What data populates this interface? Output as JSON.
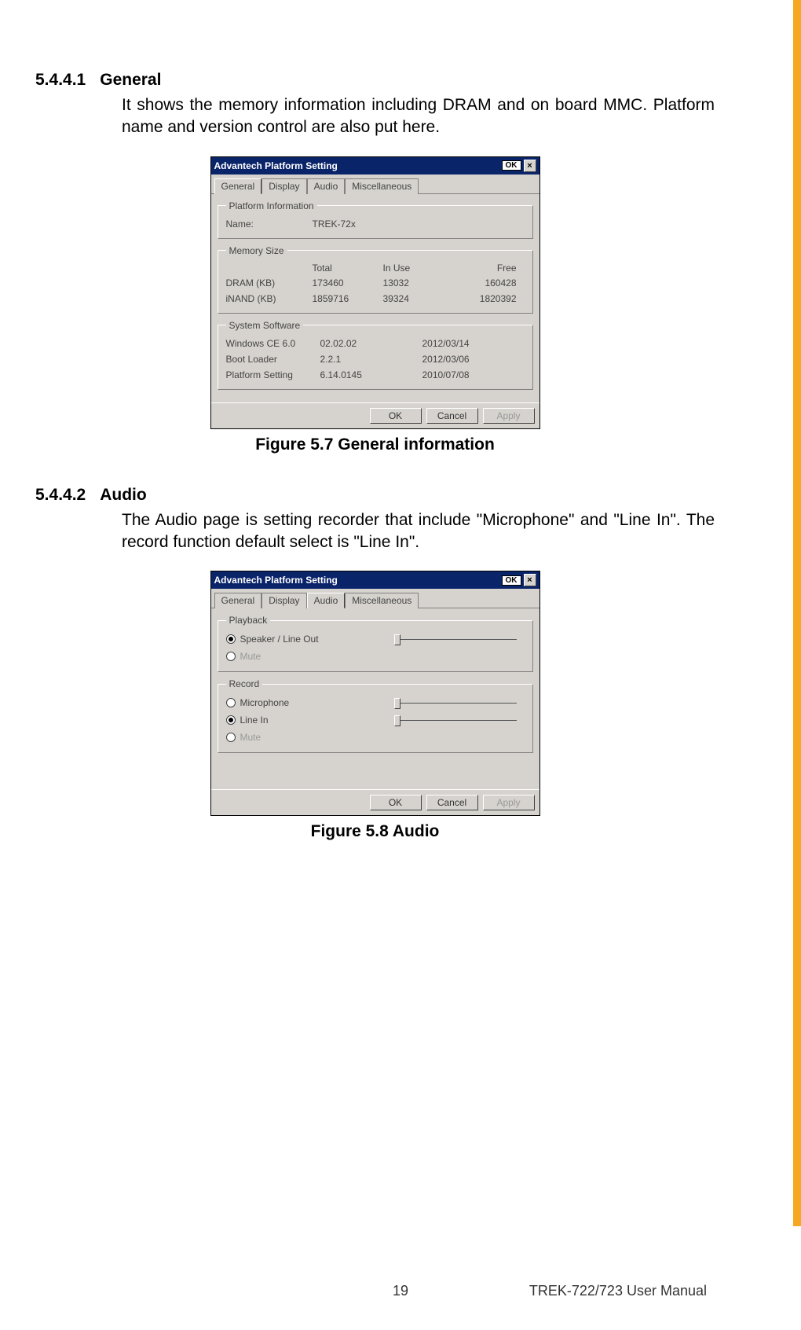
{
  "sections": {
    "general": {
      "num": "5.4.4.1",
      "title": "General",
      "body": "It shows the memory information including DRAM and on board MMC. Platform name and version control are also put here.",
      "caption": "Figure 5.7 General information"
    },
    "audio": {
      "num": "5.4.4.2",
      "title": "Audio",
      "body": "The Audio page is setting recorder that include \"Microphone\" and \"Line In\". The record function default select is \"Line In\".",
      "caption": "Figure 5.8 Audio"
    }
  },
  "dialog1": {
    "title": "Advantech Platform Setting",
    "ok": "OK",
    "tabs": {
      "general": "General",
      "display": "Display",
      "audio": "Audio",
      "misc": "Miscellaneous"
    },
    "platform": {
      "legend": "Platform Information",
      "name_lbl": "Name:",
      "name_val": "TREK-72x"
    },
    "memory": {
      "legend": "Memory Size",
      "h_total": "Total",
      "h_inuse": "In Use",
      "h_free": "Free",
      "rows": {
        "dram": {
          "name": "DRAM (KB)",
          "total": "173460",
          "inuse": "13032",
          "free": "160428"
        },
        "inand": {
          "name": "iNAND (KB)",
          "total": "1859716",
          "inuse": "39324",
          "free": "1820392"
        }
      }
    },
    "software": {
      "legend": "System Software",
      "rows": {
        "wince": {
          "name": "Windows CE 6.0",
          "ver": "02.02.02",
          "date": "2012/03/14"
        },
        "boot": {
          "name": "Boot Loader",
          "ver": "2.2.1",
          "date": "2012/03/06"
        },
        "plat": {
          "name": "Platform Setting",
          "ver": "6.14.0145",
          "date": "2010/07/08"
        }
      }
    },
    "buttons": {
      "ok": "OK",
      "cancel": "Cancel",
      "apply": "Apply"
    }
  },
  "dialog2": {
    "title": "Advantech Platform Setting",
    "ok": "OK",
    "tabs": {
      "general": "General",
      "display": "Display",
      "audio": "Audio",
      "misc": "Miscellaneous"
    },
    "playback": {
      "legend": "Playback",
      "speaker": "Speaker / Line Out",
      "mute": "Mute"
    },
    "record": {
      "legend": "Record",
      "mic": "Microphone",
      "linein": "Line In",
      "mute": "Mute"
    },
    "buttons": {
      "ok": "OK",
      "cancel": "Cancel",
      "apply": "Apply"
    }
  },
  "footer": {
    "page": "19",
    "manual": "TREK-722/723 User Manual"
  }
}
